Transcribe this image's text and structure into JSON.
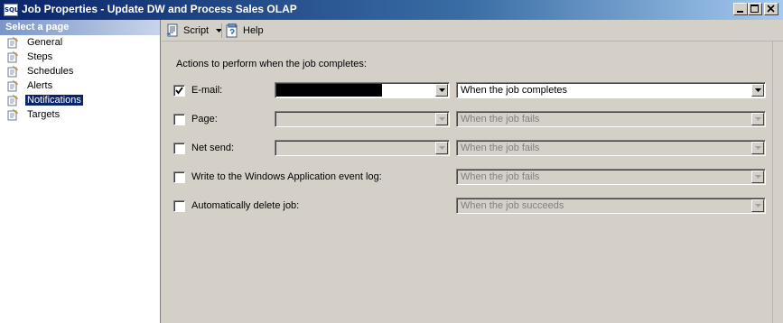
{
  "window": {
    "title": "Job Properties - Update DW and Process Sales OLAP",
    "icon_text": "SQL"
  },
  "sidebar": {
    "header": "Select a page",
    "items": [
      {
        "label": "General",
        "selected": false
      },
      {
        "label": "Steps",
        "selected": false
      },
      {
        "label": "Schedules",
        "selected": false
      },
      {
        "label": "Alerts",
        "selected": false
      },
      {
        "label": "Notifications",
        "selected": true
      },
      {
        "label": "Targets",
        "selected": false
      }
    ]
  },
  "toolbar": {
    "script_label": "Script",
    "help_label": "Help"
  },
  "notifications": {
    "section_label": "Actions to perform when the job completes:",
    "email": {
      "label": "E-mail:",
      "checked": true,
      "operator_value": "",
      "condition": "When the job completes"
    },
    "page": {
      "label": "Page:",
      "checked": false,
      "operator_value": "",
      "condition": "When the job fails"
    },
    "net_send": {
      "label": "Net send:",
      "checked": false,
      "operator_value": "",
      "condition": "When the job fails"
    },
    "event_log": {
      "label": "Write to the Windows Application event log:",
      "checked": false,
      "condition": "When the job fails"
    },
    "auto_delete": {
      "label": "Automatically delete job:",
      "checked": false,
      "condition": "When the job succeeds"
    }
  },
  "colors": {
    "title_bar": "#0a246a",
    "selection": "#0a246a",
    "face": "#d4d0c8"
  },
  "icons": {
    "app": "sql-app-icon",
    "nav": "page-icon",
    "script": "script-icon",
    "help": "help-icon"
  }
}
